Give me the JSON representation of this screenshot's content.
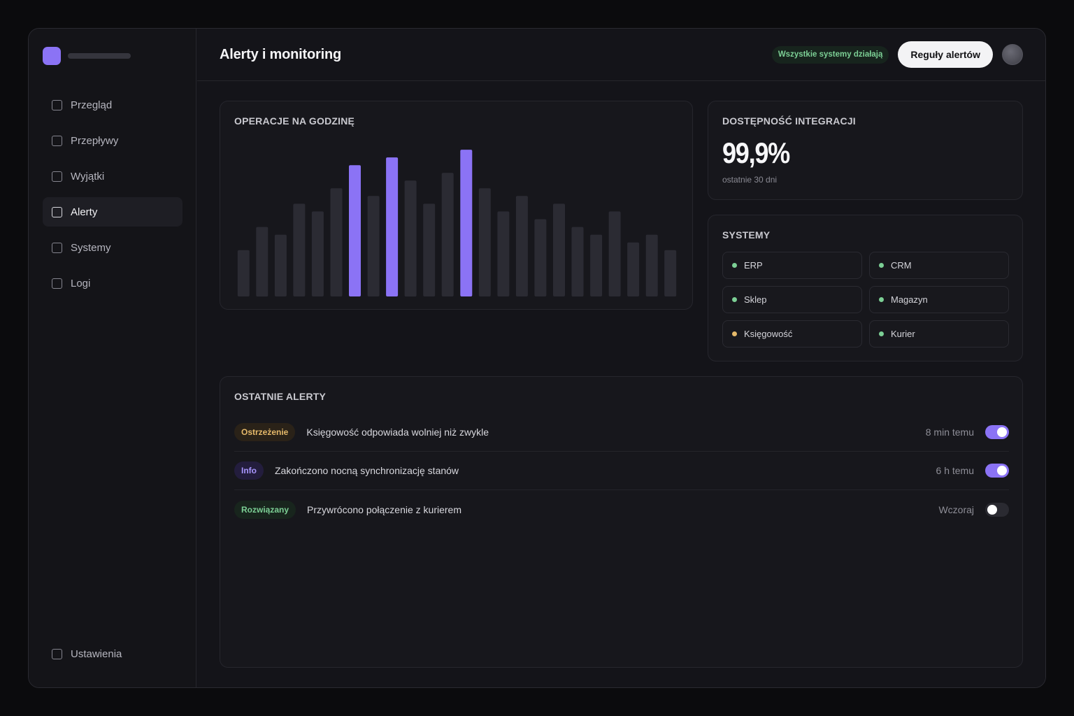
{
  "sidebar": {
    "items": [
      {
        "label": "Przegląd",
        "active": false
      },
      {
        "label": "Przepływy",
        "active": false
      },
      {
        "label": "Wyjątki",
        "active": false
      },
      {
        "label": "Alerty",
        "active": true
      },
      {
        "label": "Systemy",
        "active": false
      },
      {
        "label": "Logi",
        "active": false
      }
    ],
    "settings_label": "Ustawienia"
  },
  "header": {
    "title": "Alerty i monitoring",
    "status": "Wszystkie systemy działają",
    "rules_button": "Reguły alertów"
  },
  "colors": {
    "accent": "#8b73f5",
    "bar_default": "#2b2b33",
    "status_green": "#7ccf95",
    "status_yellow": "#e5b96a"
  },
  "operations": {
    "title": "OPERACJE NA GODZINĘ"
  },
  "chart_data": {
    "type": "bar",
    "title": "OPERACJE NA GODZINĘ",
    "values": [
      30,
      45,
      40,
      60,
      55,
      70,
      85,
      65,
      90,
      75,
      60,
      80,
      95,
      70,
      55,
      65,
      50,
      60,
      45,
      40,
      55,
      35,
      40,
      30
    ],
    "highlighted": [
      6,
      8,
      12
    ],
    "ylim": [
      0,
      100
    ],
    "grid": false
  },
  "uptime": {
    "title": "DOSTĘPNOŚĆ INTEGRACJI",
    "value": "99,9%",
    "period": "ostatnie 30 dni"
  },
  "systems": {
    "title": "SYSTEMY",
    "items": [
      {
        "name": "ERP",
        "status": "green"
      },
      {
        "name": "CRM",
        "status": "green"
      },
      {
        "name": "Sklep",
        "status": "green"
      },
      {
        "name": "Magazyn",
        "status": "green"
      },
      {
        "name": "Księgowość",
        "status": "yellow"
      },
      {
        "name": "Kurier",
        "status": "green"
      }
    ]
  },
  "alerts": {
    "title": "OSTATNIE ALERTY",
    "items": [
      {
        "level": "Ostrzeżenie",
        "text": "Księgowość odpowiada wolniej niż zwykle",
        "time": "8 min temu",
        "enabled": true,
        "badge_bg": "#2a2218",
        "badge_fg": "#e5b96a"
      },
      {
        "level": "Info",
        "text": "Zakończono nocną synchronizację stanów",
        "time": "6 h temu",
        "enabled": true,
        "badge_bg": "#231d3d",
        "badge_fg": "#a996ff"
      },
      {
        "level": "Rozwiązany",
        "text": "Przywrócono połączenie z kurierem",
        "time": "Wczoraj",
        "enabled": false,
        "badge_bg": "#18251d",
        "badge_fg": "#7ccf95"
      }
    ]
  }
}
